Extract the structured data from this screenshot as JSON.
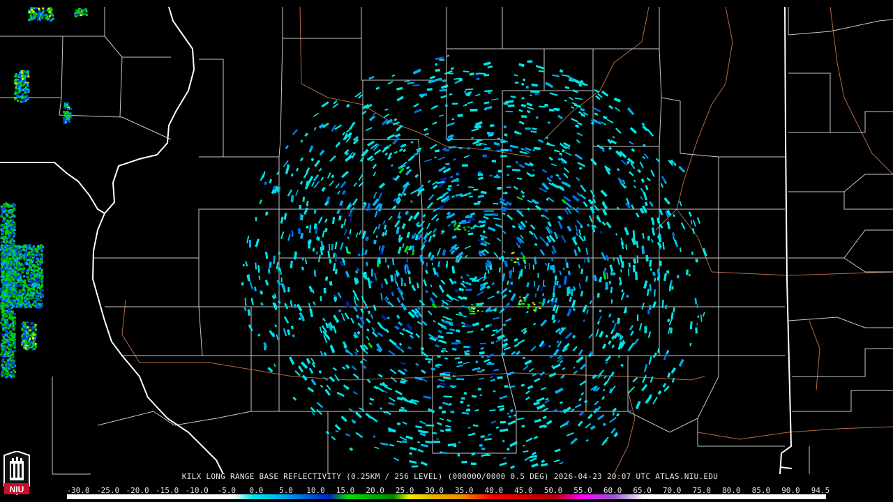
{
  "header": {
    "title": "KILX LONG RANGE BASE REFLECTIVITY (0.25KM / 256 LEVEL) (000000/0000 0.5 DEG) 2026-04-23 20:07 UTC  ATLAS.NIU.EDU"
  },
  "logo": {
    "text": "NIU",
    "icon": "niu-logo-icon"
  },
  "scale": {
    "labels": [
      "-30.0",
      "-25.0",
      "-20.0",
      "-15.0",
      "-10.0",
      "-5.0",
      "0.0",
      "5.0",
      "10.0",
      "15.0",
      "20.0",
      "25.0",
      "30.0",
      "35.0",
      "40.0",
      "45.0",
      "50.0",
      "55.0",
      "60.0",
      "65.0",
      "70.0",
      "75.0",
      "80.0",
      "85.0",
      "90.0",
      "94.5"
    ],
    "colors": {
      "neg": "#ffffff",
      "c0": "#00e5e5",
      "c5": "#00b0f0",
      "c10": "#0070e0",
      "c15": "#0020c0",
      "c20": "#00e000",
      "c25": "#00b400",
      "c30": "#008800",
      "c35": "#f0f000",
      "c40": "#e0b800",
      "c45": "#f08c00",
      "c50": "#ff0000",
      "c55": "#d40000",
      "c60": "#b00000",
      "c65": "#ff00ff",
      "c70": "#9955cc",
      "c75": "#ffffff"
    }
  },
  "map": {
    "radar_site": "KILX",
    "colors": {
      "county": "#cccccc",
      "state": "#ffffff",
      "highway": "#b86a40",
      "background": "#000000"
    },
    "echo_colors": [
      "#00e5e5",
      "#00b0f0",
      "#0070e0",
      "#0020c0",
      "#00e000",
      "#f0f000"
    ]
  }
}
